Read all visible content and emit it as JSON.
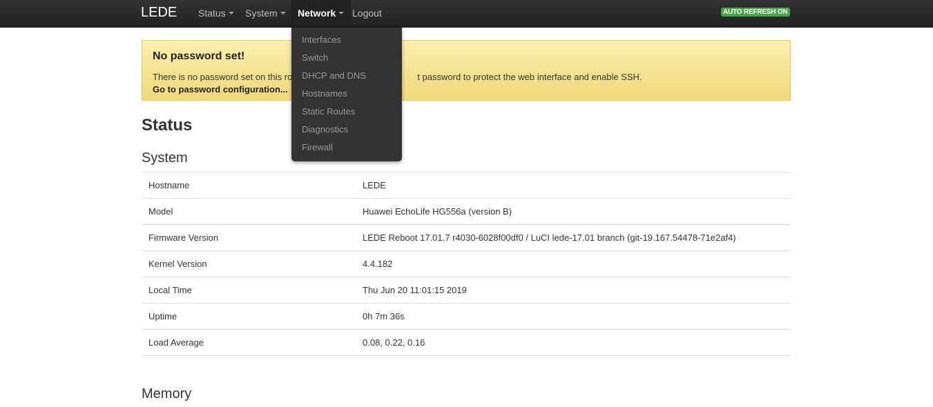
{
  "topbar": {
    "brand": "LEDE",
    "menu": [
      {
        "label": "Status"
      },
      {
        "label": "System"
      },
      {
        "label": "Network"
      },
      {
        "label": "Logout"
      }
    ],
    "auto_refresh": "AUTO REFRESH ON"
  },
  "dropdown": {
    "items": [
      "Interfaces",
      "Switch",
      "DHCP and DNS",
      "Hostnames",
      "Static Routes",
      "Diagnostics",
      "Firewall"
    ]
  },
  "alert": {
    "title": "No password set!",
    "text_visible": "There is no password set on this ro",
    "text_after_dropdown": "t password to protect the web interface and enable SSH.",
    "link": "Go to password configuration..."
  },
  "page": {
    "title": "Status",
    "system_heading": "System",
    "memory_heading": "Memory"
  },
  "system": {
    "rows": [
      {
        "key": "Hostname",
        "value": "LEDE"
      },
      {
        "key": "Model",
        "value": "Huawei EchoLife HG556a (version B)"
      },
      {
        "key": "Firmware Version",
        "value": "LEDE Reboot 17.01.7 r4030-6028f00df0 / LuCI lede-17.01 branch (git-19.167.54478-71e2af4)"
      },
      {
        "key": "Kernel Version",
        "value": "4.4.182"
      },
      {
        "key": "Local Time",
        "value": "Thu Jun 20 11:01:15 2019"
      },
      {
        "key": "Uptime",
        "value": "0h 7m 36s"
      },
      {
        "key": "Load Average",
        "value": "0.08, 0.22, 0.16"
      }
    ]
  },
  "colors": {
    "topbar": "#222222",
    "alert_bg": "#fbeeb0",
    "badge": "#46a546"
  }
}
